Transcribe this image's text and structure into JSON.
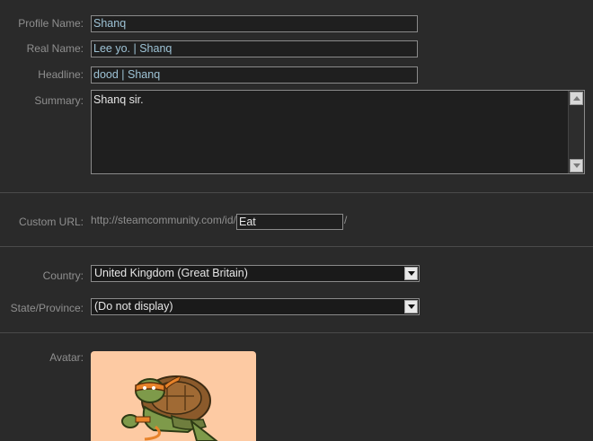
{
  "profile_name": {
    "label": "Profile Name:",
    "value": "Shanq"
  },
  "real_name": {
    "label": "Real Name:",
    "value": "Lee yo. | Shanq"
  },
  "headline": {
    "label": "Headline:",
    "value": "dood | Shanq"
  },
  "summary": {
    "label": "Summary:",
    "value": "Shanq sir."
  },
  "custom_url": {
    "label": "Custom URL:",
    "prefix": "http://steamcommunity.com/id/",
    "value": "Eat",
    "suffix": "/"
  },
  "country": {
    "label": "Country:",
    "selected": "United Kingdom (Great Britain)"
  },
  "state": {
    "label": "State/Province:",
    "selected": "(Do not display)"
  },
  "avatar": {
    "label": "Avatar:",
    "icon": "turtle-avatar-image",
    "bg_color": "#fdcaa3"
  },
  "colors": {
    "background": "#2a2a2a",
    "label": "#8f8f8f",
    "field_text": "#9ec3d6"
  }
}
